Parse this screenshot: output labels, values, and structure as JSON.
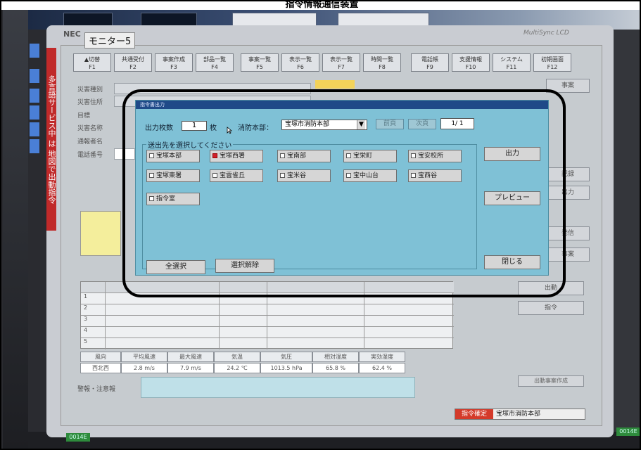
{
  "caption": "指令情報通信装置",
  "monitor": {
    "brand": "NEC",
    "window_title": "モニター5",
    "brand_right": "MultiSync LCD"
  },
  "side_banner": "多言語サービス中 は 地図で出動指令",
  "function_keys": [
    {
      "label": "▲切替",
      "key": "F1"
    },
    {
      "label": "共通受付",
      "key": "F2"
    },
    {
      "label": "事案作成",
      "key": "F3"
    },
    {
      "label": "部品一覧",
      "key": "F4"
    },
    {
      "label": "事案一覧",
      "key": "F5"
    },
    {
      "label": "表示一覧",
      "key": "F6"
    },
    {
      "label": "表示一覧",
      "key": "F7"
    },
    {
      "label": "時間一覧",
      "key": "F8"
    },
    {
      "label": "電話帳",
      "key": "F9"
    },
    {
      "label": "支援情報",
      "key": "F10"
    },
    {
      "label": "システム",
      "key": "F11"
    },
    {
      "label": "初期画面",
      "key": "F12"
    }
  ],
  "background": {
    "field_labels": [
      "災害種別",
      "災害住所",
      "目標",
      "災害名称",
      "通報者名",
      "電話番号"
    ],
    "side_buttons": [
      "事案",
      "記録",
      "出力",
      "発信",
      "事案",
      "出動",
      "指令"
    ],
    "row_numbers": [
      "1",
      "2",
      "3",
      "4",
      "5"
    ],
    "weather_headers": [
      "風向",
      "平均風速",
      "最大風速",
      "気温",
      "気圧",
      "相対湿度",
      "実効湿度"
    ],
    "weather_values": [
      "西北西",
      "2.8 m/s",
      "7.9 m/s",
      "24.2 ℃",
      "1013.5 hPa",
      "65.8 %",
      "62.4 %"
    ],
    "alert_label": "警報・注意報",
    "status_button": "出動事案作成",
    "status_tag": "指令確定",
    "status_text": "宝塚市消防本部",
    "badge_left": "0014E",
    "badge_right": "0014E"
  },
  "dialog": {
    "title": "指令書出力",
    "count_label": "出力枚数",
    "count_value": "1",
    "count_unit": "枚",
    "dept_label": "消防本部：",
    "dept_value": "宝塚市消防本部",
    "prev_label": "前頁",
    "next_label": "次頁",
    "page_indicator": "1/ 1",
    "dest_label": "送出先を選択してください",
    "destinations": [
      {
        "label": "宝塚本部",
        "checked": false
      },
      {
        "label": "宝塚西署",
        "checked": true
      },
      {
        "label": "宝南部",
        "checked": false
      },
      {
        "label": "宝栄町",
        "checked": false
      },
      {
        "label": "宝安校所",
        "checked": false
      },
      {
        "label": "宝塚東署",
        "checked": false
      },
      {
        "label": "宝雲雀丘",
        "checked": false
      },
      {
        "label": "宝米谷",
        "checked": false
      },
      {
        "label": "宝中山台",
        "checked": false
      },
      {
        "label": "宝西谷",
        "checked": false
      },
      {
        "label": "指令室",
        "checked": false
      }
    ],
    "output_button": "出力",
    "preview_button": "プレビュー",
    "close_button": "閉じる",
    "select_all_button": "全選択",
    "deselect_button": "選択解除"
  }
}
